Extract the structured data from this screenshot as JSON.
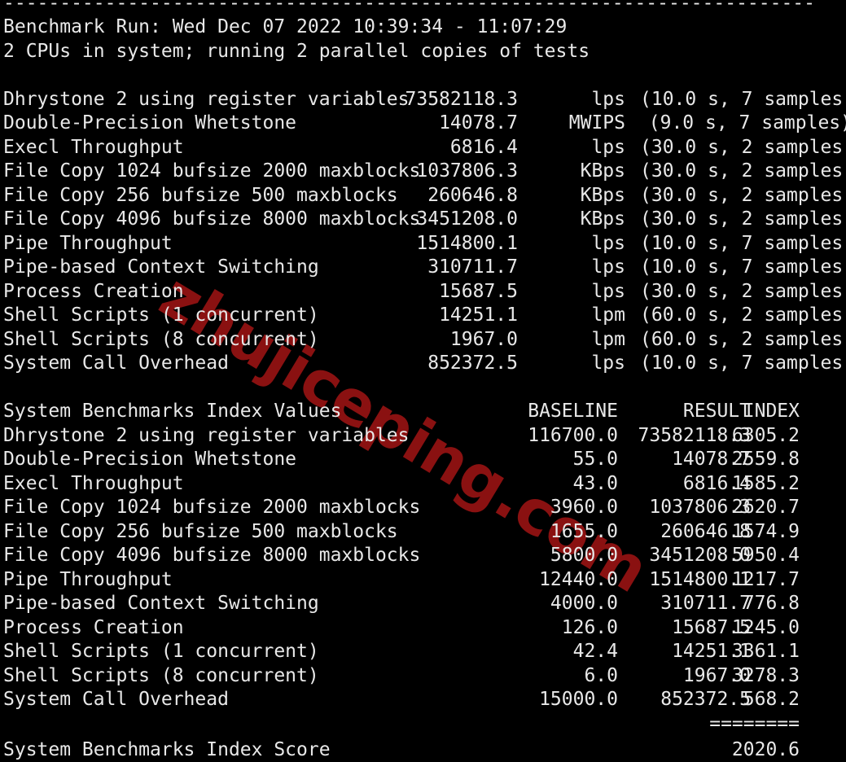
{
  "terminal": {
    "top_rule": "------------------------------------------------------------------------",
    "header": {
      "benchmark_run": "Benchmark Run: Wed Dec 07 2022 10:39:34 - 11:07:29",
      "cpu_line": "2 CPUs in system; running 2 parallel copies of tests"
    },
    "raw_results": [
      {
        "label": "Dhrystone 2 using register variables",
        "value": "73582118.3",
        "unit": "lps",
        "note": "(10.0 s, 7 samples)"
      },
      {
        "label": "Double-Precision Whetstone",
        "value": "14078.7",
        "unit": "MWIPS",
        "note": "(9.0 s, 7 samples)"
      },
      {
        "label": "Execl Throughput",
        "value": "6816.4",
        "unit": "lps",
        "note": "(30.0 s, 2 samples)"
      },
      {
        "label": "File Copy 1024 bufsize 2000 maxblocks",
        "value": "1037806.3",
        "unit": "KBps",
        "note": "(30.0 s, 2 samples)"
      },
      {
        "label": "File Copy 256 bufsize 500 maxblocks",
        "value": "260646.8",
        "unit": "KBps",
        "note": "(30.0 s, 2 samples)"
      },
      {
        "label": "File Copy 4096 bufsize 8000 maxblocks",
        "value": "3451208.0",
        "unit": "KBps",
        "note": "(30.0 s, 2 samples)"
      },
      {
        "label": "Pipe Throughput",
        "value": "1514800.1",
        "unit": "lps",
        "note": "(10.0 s, 7 samples)"
      },
      {
        "label": "Pipe-based Context Switching",
        "value": "310711.7",
        "unit": "lps",
        "note": "(10.0 s, 7 samples)"
      },
      {
        "label": "Process Creation",
        "value": "15687.5",
        "unit": "lps",
        "note": "(30.0 s, 2 samples)"
      },
      {
        "label": "Shell Scripts (1 concurrent)",
        "value": "14251.1",
        "unit": "lpm",
        "note": "(60.0 s, 2 samples)"
      },
      {
        "label": "Shell Scripts (8 concurrent)",
        "value": "1967.0",
        "unit": "lpm",
        "note": "(60.0 s, 2 samples)"
      },
      {
        "label": "System Call Overhead",
        "value": "852372.5",
        "unit": "lps",
        "note": "(10.0 s, 7 samples)"
      }
    ],
    "index_table": {
      "title": "System Benchmarks Index Values",
      "columns": {
        "baseline": "BASELINE",
        "result": "RESULT",
        "index": "INDEX"
      },
      "rows": [
        {
          "label": "Dhrystone 2 using register variables",
          "baseline": "116700.0",
          "result": "73582118.3",
          "index": "6305.2"
        },
        {
          "label": "Double-Precision Whetstone",
          "baseline": "55.0",
          "result": "14078.7",
          "index": "2559.8"
        },
        {
          "label": "Execl Throughput",
          "baseline": "43.0",
          "result": "6816.4",
          "index": "1585.2"
        },
        {
          "label": "File Copy 1024 bufsize 2000 maxblocks",
          "baseline": "3960.0",
          "result": "1037806.3",
          "index": "2620.7"
        },
        {
          "label": "File Copy 256 bufsize 500 maxblocks",
          "baseline": "1655.0",
          "result": "260646.8",
          "index": "1574.9"
        },
        {
          "label": "File Copy 4096 bufsize 8000 maxblocks",
          "baseline": "5800.0",
          "result": "3451208.0",
          "index": "5950.4"
        },
        {
          "label": "Pipe Throughput",
          "baseline": "12440.0",
          "result": "1514800.1",
          "index": "1217.7"
        },
        {
          "label": "Pipe-based Context Switching",
          "baseline": "4000.0",
          "result": "310711.7",
          "index": "776.8"
        },
        {
          "label": "Process Creation",
          "baseline": "126.0",
          "result": "15687.5",
          "index": "1245.0"
        },
        {
          "label": "Shell Scripts (1 concurrent)",
          "baseline": "42.4",
          "result": "14251.1",
          "index": "3361.1"
        },
        {
          "label": "Shell Scripts (8 concurrent)",
          "baseline": "6.0",
          "result": "1967.0",
          "index": "3278.3"
        },
        {
          "label": "System Call Overhead",
          "baseline": "15000.0",
          "result": "852372.5",
          "index": "568.2"
        }
      ],
      "separator": "========",
      "score_label": "System Benchmarks Index Score",
      "score_value": "2020.6"
    }
  },
  "watermark": {
    "text": "zhujiceping.com",
    "color": "#8a1111"
  },
  "theme": {
    "background": "#000000",
    "foreground": "#e8e8e8"
  }
}
